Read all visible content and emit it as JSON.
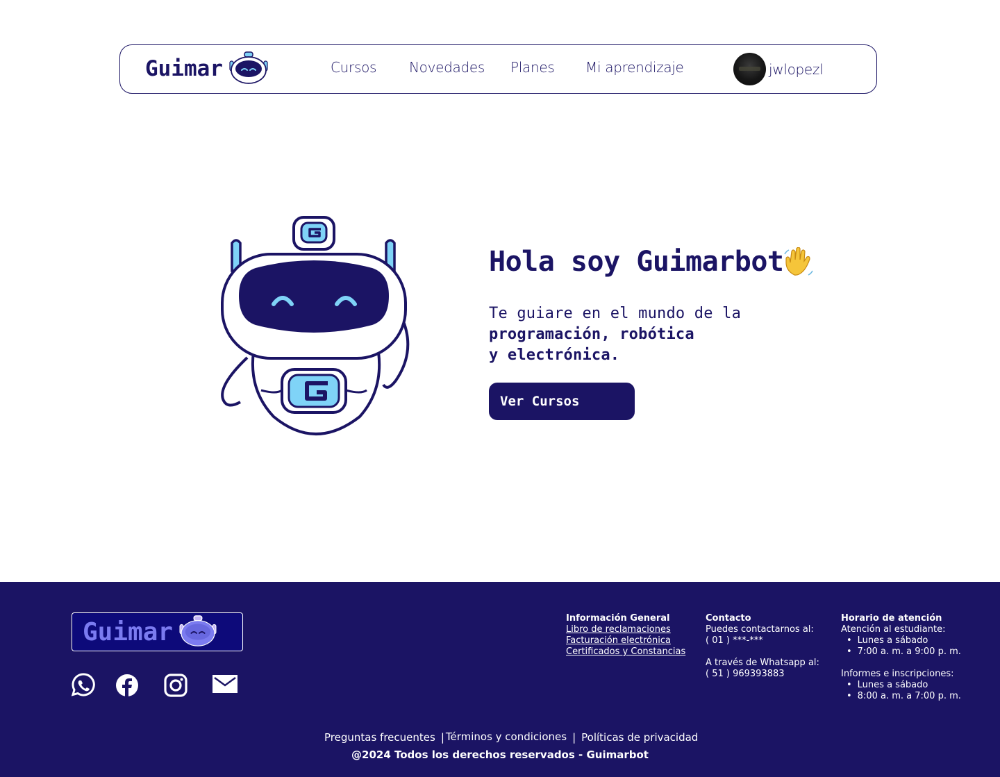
{
  "colors": {
    "brand": "#1b1464",
    "accent_light": "#7fd3f7",
    "footer_logo_text": "#7b7bf0"
  },
  "nav": {
    "logo_text": "Guimar",
    "links": [
      "Cursos",
      "Novedades",
      "Planes",
      "Mi aprendizaje"
    ],
    "username": "jwlopezl"
  },
  "hero": {
    "title": "Hola soy Guimarbot",
    "subtitle_line1": "Te guiare en el mundo de la",
    "subtitle_line2": "programación, robótica",
    "subtitle_line3": "y electrónica.",
    "cta_label": "Ver Cursos"
  },
  "footer": {
    "logo_text": "Guimar",
    "social_icons": [
      "whatsapp-icon",
      "facebook-icon",
      "instagram-icon",
      "mail-icon"
    ],
    "info": {
      "title": "Información General",
      "links": [
        "Libro de reclamaciones",
        "Facturación electrónica",
        "Certificados y Constancias"
      ]
    },
    "contact": {
      "title": "Contacto",
      "line1": "Puedes contactarnos al:",
      "phone1": "( 01 ) ***-***",
      "line2": "A través de Whatsapp al:",
      "phone2": "( 51 ) 969393883"
    },
    "schedule": {
      "title": "Horario de atención",
      "student_label": "Atención al estudiante:",
      "student_days": "Lunes a sábado",
      "student_hours": "7:00 a. m. a 9:00 p. m.",
      "info_label": "Informes e inscripciones:",
      "info_days": "Lunes a sábado",
      "info_hours": "8:00 a. m. a 7:00 p. m."
    },
    "bottom_links": [
      "Preguntas frecuentes",
      "Términos y condiciones",
      "Políticas de privacidad"
    ],
    "separator": "|",
    "copyright": "@2024 Todos los derechos reservados - Guimarbot"
  }
}
